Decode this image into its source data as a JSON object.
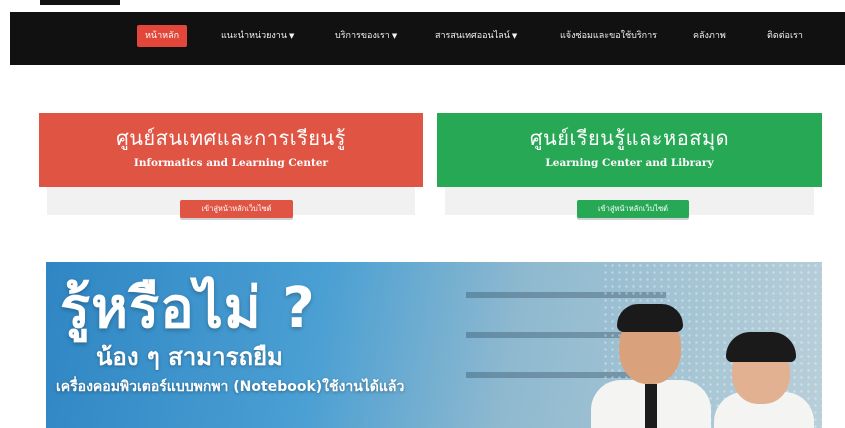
{
  "nav": {
    "items": [
      {
        "label": "หน้าหลัก",
        "dropdown": false,
        "active": true
      },
      {
        "label": "แนะนำหน่วยงาน",
        "dropdown": true,
        "active": false
      },
      {
        "label": "บริการของเรา",
        "dropdown": true,
        "active": false
      },
      {
        "label": "สารสนเทศออนไลน์",
        "dropdown": true,
        "active": false
      },
      {
        "label": "แจ้งซ่อมและขอใช้บริการ",
        "dropdown": false,
        "active": false
      },
      {
        "label": "คลังภาพ",
        "dropdown": false,
        "active": false
      },
      {
        "label": "ติดต่อเรา",
        "dropdown": false,
        "active": false
      }
    ],
    "caret_icon": "chevron-down-icon"
  },
  "cards": [
    {
      "title_th": "ศูนย์สนเทศและการเรียนรู้",
      "title_en": "Informatics and Learning Center",
      "button": "เข้าสู่หน้าหลักเว็บไซต์",
      "color": "#e05444"
    },
    {
      "title_th": "ศูนย์เรียนรู้และหอสมุด",
      "title_en": "Learning Center and Library",
      "button": "เข้าสู่หน้าหลักเว็บไซต์",
      "color": "#27a855"
    }
  ],
  "banner": {
    "headline": "รู้หรือไม่ ?",
    "subheadline": "น้อง ๆ สามารถยืม",
    "line": "เครื่องคอมพิวเตอร์แบบพกพา (Notebook)ใช้งานได้แล้ว"
  },
  "colors": {
    "navbar": "#111111",
    "accent_red": "#e05444",
    "accent_green": "#27a855"
  }
}
